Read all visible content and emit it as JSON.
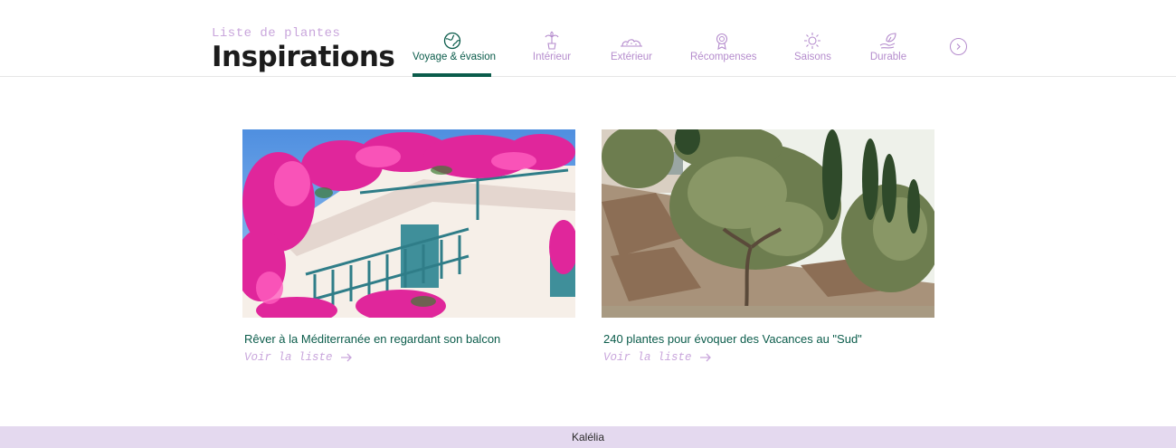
{
  "header": {
    "subtitle": "Liste de plantes",
    "title": "Inspirations"
  },
  "tabs": [
    {
      "label": "Voyage & évasion",
      "icon": "globe-icon",
      "active": true
    },
    {
      "label": "Intérieur",
      "icon": "potted-palm-icon",
      "active": false
    },
    {
      "label": "Extérieur",
      "icon": "garden-icon",
      "active": false
    },
    {
      "label": "Récompenses",
      "icon": "award-medal-icon",
      "active": false
    },
    {
      "label": "Saisons",
      "icon": "sun-leaf-icon",
      "active": false
    },
    {
      "label": "Durable",
      "icon": "hand-leaf-icon",
      "active": false
    }
  ],
  "colors": {
    "accent_green": "#0b5c4b",
    "accent_lilac": "#b58ccd",
    "footer_bg": "#e4d9ef"
  },
  "cards": [
    {
      "title": "Rêver à la Méditerranée en regardant son balcon",
      "link": "Voir la liste",
      "image": "balcony-bougainvillea-photo"
    },
    {
      "title": "240 plantes pour évoquer des Vacances au \"Sud\"",
      "link": "Voir la liste",
      "image": "olive-tree-garden-photo"
    }
  ],
  "footer": {
    "brand": "Kalélia"
  }
}
